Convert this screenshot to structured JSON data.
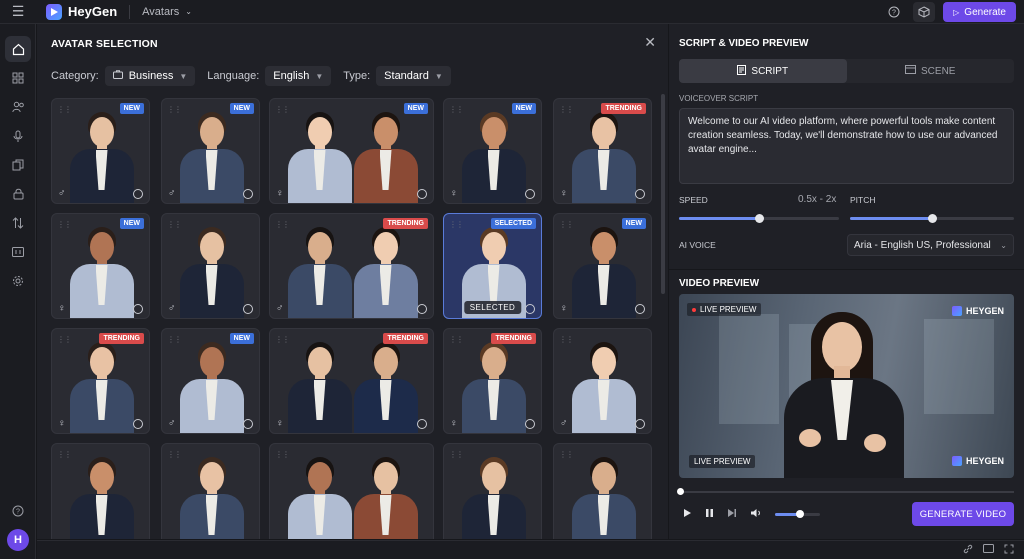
{
  "app": {
    "name": "HeyGen",
    "section": "Avatars",
    "generate_label": "Generate"
  },
  "colors": {
    "accent": "#6d49e8",
    "new_badge": "#3b6fd9",
    "trending_badge": "#d94b4b"
  },
  "avatar_selection": {
    "title": "AVATAR SELECTION",
    "filters": {
      "category_label": "Category:",
      "category_value": "Business",
      "language_label": "Language:",
      "language_value": "English",
      "type_label": "Type:",
      "type_value": "Standard"
    },
    "cards": [
      {
        "badge": "NEW",
        "gender": "♂"
      },
      {
        "badge": "NEW",
        "gender": "♂"
      },
      {
        "badge": "NEW",
        "gender": "♀"
      },
      {
        "badge": "NEW",
        "gender": "♀"
      },
      {
        "badge": "TRENDING",
        "gender": "♀"
      },
      {
        "badge": "NEW",
        "gender": "♀"
      },
      {
        "badge": "",
        "gender": "♂"
      },
      {
        "badge": "TRENDING",
        "gender": "♂"
      },
      {
        "badge": "SELECTED",
        "gender": "",
        "selected_label": "SELECTED"
      },
      {
        "badge": "NEW",
        "gender": "♀"
      },
      {
        "badge": "TRENDING",
        "gender": "♀"
      },
      {
        "badge": "NEW",
        "gender": "♂"
      },
      {
        "badge": "TRENDING",
        "gender": "♀"
      },
      {
        "badge": "TRENDING",
        "gender": "♀"
      },
      {
        "badge": "",
        "gender": "♂"
      },
      {
        "badge": "",
        "gender": ""
      },
      {
        "badge": "",
        "gender": ""
      },
      {
        "badge": "",
        "gender": ""
      },
      {
        "badge": "",
        "gender": ""
      },
      {
        "badge": "",
        "gender": ""
      }
    ]
  },
  "script_preview": {
    "title": "SCRIPT & VIDEO PREVIEW",
    "tab_script": "SCRIPT",
    "tab_scene": "SCENE",
    "voiceover_label": "VOICEOVER SCRIPT",
    "voiceover_text": "Welcome to our AI video platform, where powerful tools make content creation seamless. Today, we'll demonstrate how to use our advanced avatar engine...",
    "speed_label": "SPEED",
    "speed_range": "0.5x - 2x",
    "speed_value": 0.5,
    "pitch_label": "PITCH",
    "pitch_value": 0.5,
    "ai_voice_label": "AI VOICE",
    "ai_voice_value": "Aria - English US, Professional"
  },
  "video_preview": {
    "title": "VIDEO PREVIEW",
    "live_preview_top": "LIVE PREVIEW",
    "live_preview_bottom": "LIVE PREVIEW",
    "watermark_top": "HEYGEN",
    "watermark_bottom": "HEYGEN",
    "progress": 0.0,
    "volume": 0.56,
    "generate_video_label": "GENERATE VIDEO"
  }
}
